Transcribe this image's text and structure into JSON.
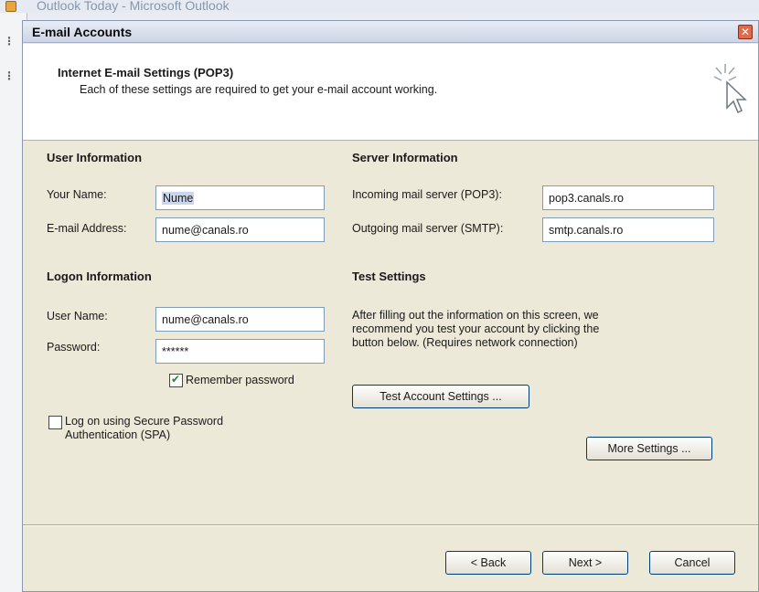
{
  "background": {
    "title": "Outlook Today - Microsoft Outlook"
  },
  "dialog": {
    "title": "E-mail Accounts",
    "header_title": "Internet E-mail Settings (POP3)",
    "header_subtitle": "Each of these settings are required to get your e-mail account working."
  },
  "user_info": {
    "title": "User Information",
    "name_label": "Your Name:",
    "name_value": "Nume",
    "email_label": "E-mail Address:",
    "email_value": "nume@canals.ro"
  },
  "server_info": {
    "title": "Server Information",
    "incoming_label": "Incoming mail server (POP3):",
    "incoming_value": "pop3.canals.ro",
    "outgoing_label": "Outgoing mail server (SMTP):",
    "outgoing_value": "smtp.canals.ro"
  },
  "logon_info": {
    "title": "Logon Information",
    "user_label": "User Name:",
    "user_value": "nume@canals.ro",
    "password_label": "Password:",
    "password_value": "******",
    "remember_label": "Remember password",
    "spa_label_line1": "Log on using Secure Password",
    "spa_label_line2": "Authentication (SPA)"
  },
  "test_settings": {
    "title": "Test Settings",
    "help_line1": "After filling out the information on this screen, we",
    "help_line2": "recommend you test your account by clicking the",
    "help_line3": "button below. (Requires network connection)",
    "test_button": "Test Account Settings ...",
    "more_button": "More Settings ..."
  },
  "footer": {
    "back": "< Back",
    "next": "Next >",
    "cancel": "Cancel"
  }
}
